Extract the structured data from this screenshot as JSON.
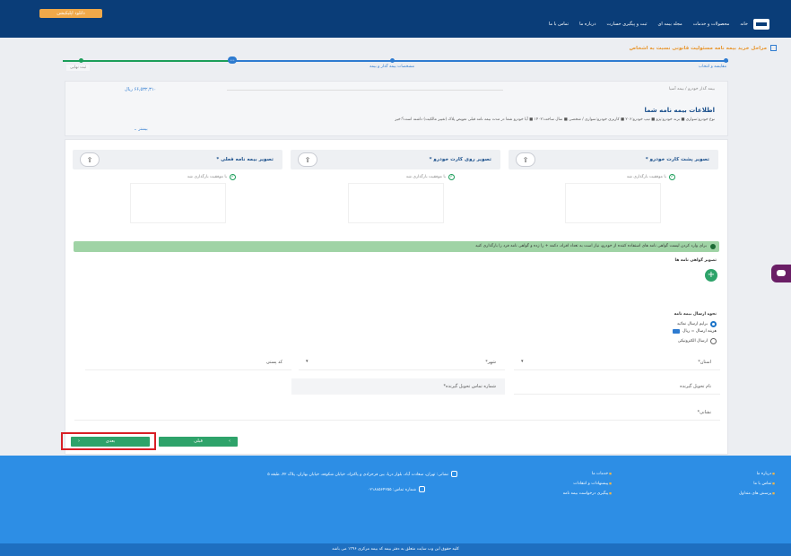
{
  "header": {
    "download_label": "دانلود اپلیکیشن",
    "nav": [
      "خانه",
      "محصولات و خدمات",
      "مجله بیمه ای",
      "ثبت و پیگیری خسارت",
      "درباره ما",
      "تماس با ما"
    ]
  },
  "section_title": "مراحل خرید بیمه نامه مسئولیت قانونی نسبت به اشخاص",
  "steps": [
    "مقایسه و انتخاب",
    "مشخصات بیمه گذار و بیمه",
    "ثبت نهایی"
  ],
  "summary": {
    "breadcrumb": "بیمه گذار خودرو  /  بیمه آسیا",
    "price": "۶۶,۵۳۲,۳۱۰ ریال",
    "title": "اطلاعات بیمه نامه شما",
    "description": "نوع خودرو:سواری  ■  برند خودرو:پژو  ■  تیپ خودرو:۲۰۶  ■  کاربری خودرو:سواری / شخصی  ■  سال ساخت:۱۴۰۲  ■  آیا خودرو شما در مدت بیمه نامه قبلی تعویض پلاک (تغییر مالکیت) داشته است؟:خیر",
    "more": "بیشتر"
  },
  "uploads": [
    {
      "title": "تصویر پشت کارت خودرو *",
      "status": "با موفقیت بارگذاری شد"
    },
    {
      "title": "تصویر روی کارت خودرو *",
      "status": "با موفقیت بارگذاری شد"
    },
    {
      "title": "تصویر بیمه نامه فعلی *",
      "status": "با موفقیت بارگذاری شد"
    }
  ],
  "alert": "برای وارد کردن لیست گواهی نامه های استفاده کننده از خودرو، نیاز است به تعداد افراد، دکمه + را زده و گواهی نامه فرد را بارگذاری کنید",
  "licenses_label": "تصویر گواهی نامه ها",
  "delivery": {
    "label": "نحوه ارسال بیمه نامه",
    "option_post": "برایم ارسال نمائید",
    "cost": "هزینه ارسال = ریال",
    "option_electronic": "ارسال الکترونیکی"
  },
  "fields": {
    "province": "استان*",
    "city": "شهر*",
    "postal_code": "کد پستی",
    "receiver_name": "نام تحویل گیرنده",
    "receiver_phone": "شماره تماس تحویل گیرنده*",
    "address": "نشانی*"
  },
  "buttons": {
    "next": "بعدی",
    "prev": "قبلی"
  },
  "footer": {
    "col1": [
      "درباره ما",
      "تماس با ما",
      "پرسش های متداول"
    ],
    "col2": [
      "خدمات ما",
      "پیشنهادات و انتقادات",
      "پیگیری درخواست بیمه نامه"
    ],
    "address": "نشانی: تهران، سعادت آباد، بلوار دریا، بین فرحزادی و پاکنژاد، خیابان شکوفه، خیابان بهاران، پلاک ۴۲، طبقه ۵",
    "phone": "شماره تماس: ۰۲۱۸۸۵۶۴۲۵۵",
    "copyright": "کلیه حقوق این وب سایت متعلق به دفتر بیمه کد بیمه مرکزی ۱۳۹۶ می باشد"
  }
}
